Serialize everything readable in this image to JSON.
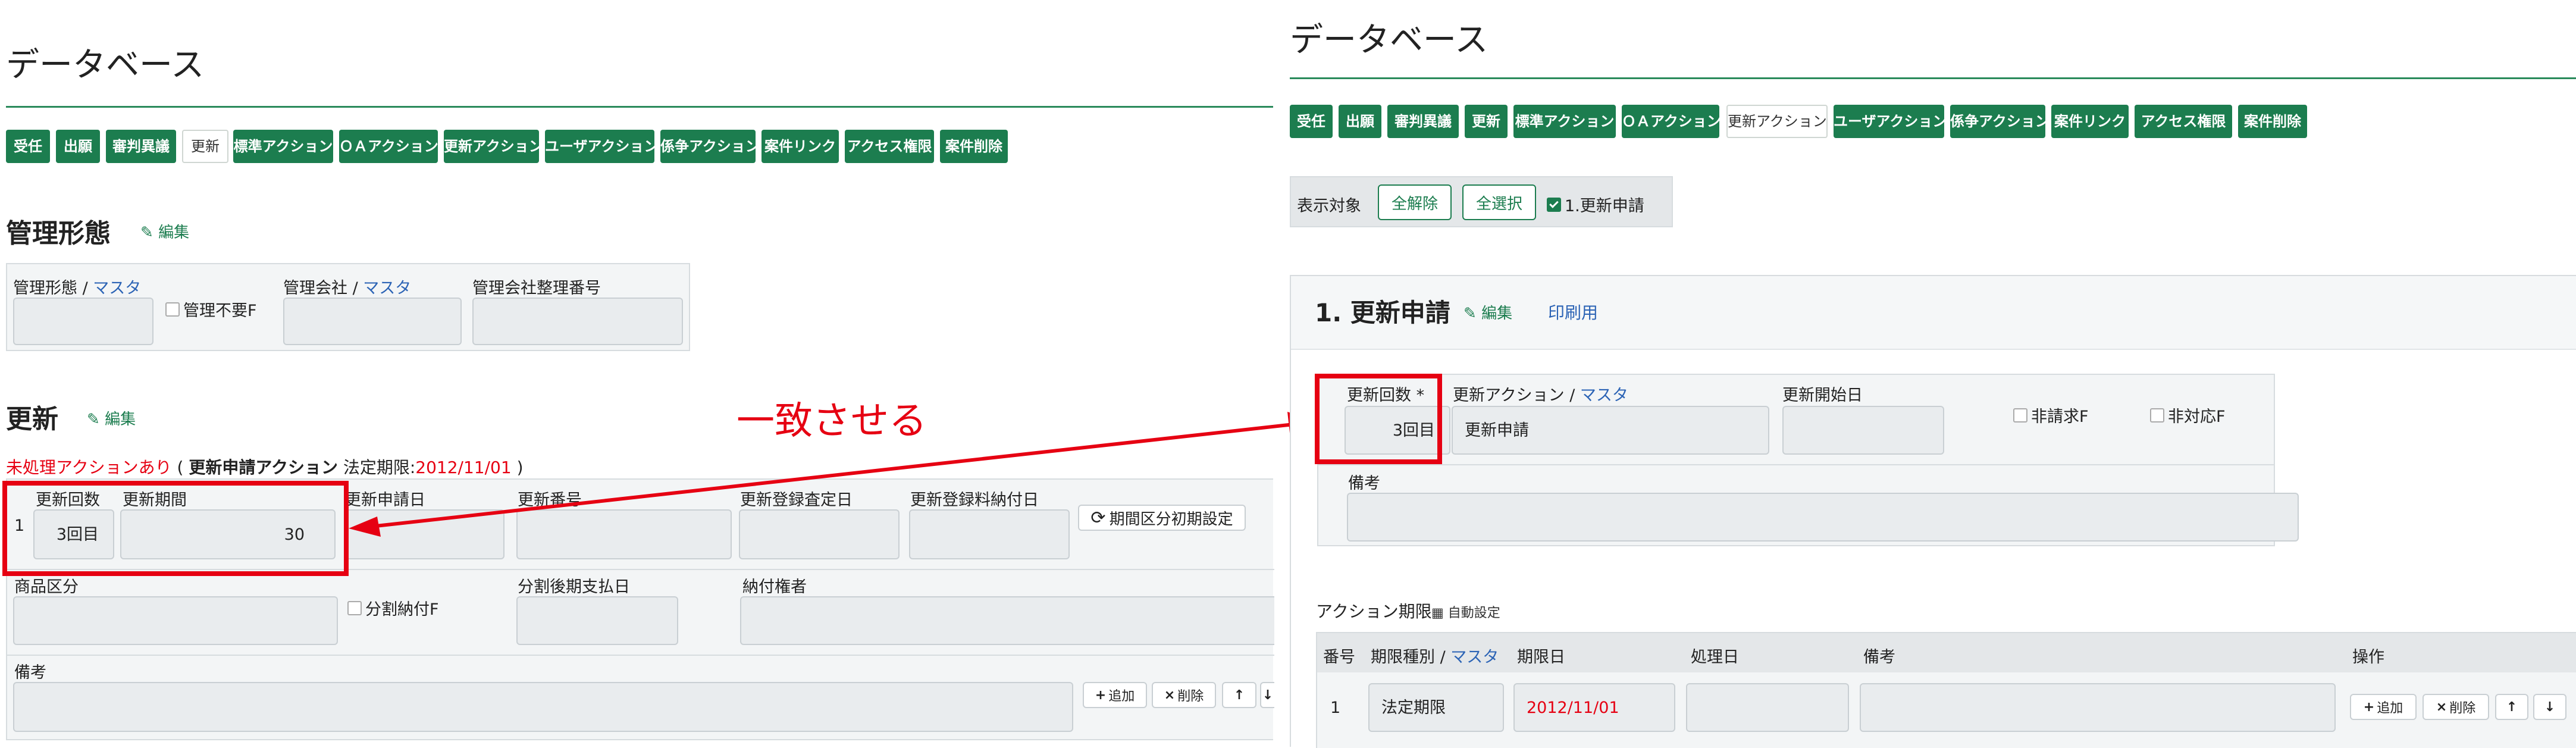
{
  "left": {
    "page_title": "データベース",
    "tabs": [
      "受任",
      "出願",
      "審判異議",
      "更新",
      "標準アクション",
      "ＯＡアクション",
      "更新アクション",
      "ユーザアクション",
      "係争アクション",
      "案件リンク",
      "アクセス権限",
      "案件削除"
    ],
    "kanri": {
      "title": "管理形態",
      "edit": "編集",
      "label_keitai": "管理形態",
      "sep": " / ",
      "master": "マスタ",
      "chk_fuyou": "管理不要F",
      "label_kaisha": "管理会社",
      "label_seiri": "管理会社整理番号"
    },
    "koshin": {
      "title": "更新",
      "edit": "編集",
      "notice_prefix": "未処理アクションあり",
      "notice_paren_open": " ( ",
      "notice_action": "更新申請アクション",
      "notice_deadline_label": " 法定期限:",
      "notice_date": "2012/11/01",
      "notice_paren_close": " )",
      "row_no": "1",
      "label_kaisu": "更新回数",
      "label_kikan": "更新期間",
      "label_shinseibi": "更新申請日",
      "label_bango": "更新番号",
      "label_satei": "更新登録査定日",
      "label_nofu": "更新登録料納付日",
      "reset_btn": "期間区分初期設定",
      "val_kaisu": "3回目",
      "val_kikan": "30",
      "label_shohin": "商品区分",
      "chk_bunkatsu": "分割納付F",
      "label_bunkatsugo": "分割後期支払日",
      "label_nofusha": "納付権者",
      "label_biko": "備考",
      "btn_add": "追加",
      "btn_del": "削除"
    },
    "annotation": "一致させる"
  },
  "right": {
    "page_title": "データベース",
    "tabs": [
      "受任",
      "出願",
      "審判異議",
      "更新",
      "標準アクション",
      "ＯＡアクション",
      "更新アクション",
      "ユーザアクション",
      "係争アクション",
      "案件リンク",
      "アクセス権限",
      "案件削除"
    ],
    "filter": {
      "label": "表示対象",
      "btn_clear": "全解除",
      "btn_all": "全選択",
      "chk_item": "1.更新申請"
    },
    "sec1": {
      "title": "1. 更新申請",
      "edit": "編集",
      "print": "印刷用",
      "label_kaisu": "更新回数",
      "required": " *",
      "label_action": "更新アクション",
      "sep": " / ",
      "master": "マスタ",
      "label_kaishi": "更新開始日",
      "chk_hiseikyu": "非請求F",
      "chk_taiou": "非対応F",
      "val_kaisu": "3回目",
      "val_action": "更新申請",
      "label_biko": "備考"
    },
    "kigen": {
      "title": "アクション期限",
      "auto": "自動設定",
      "col_no": "番号",
      "col_shubetsu": "期限種別",
      "col_kigenbi": "期限日",
      "col_shoribi": "処理日",
      "col_biko": "備考",
      "col_sousa": "操作",
      "sep": " / ",
      "master": "マスタ",
      "row_no": "1",
      "row_shubetsu": "法定期限",
      "row_kigenbi": "2012/11/01",
      "btn_add": "追加",
      "btn_del": "削除"
    }
  },
  "colors": {
    "accent": "#1c7d4f",
    "annotation_red": "#e60012",
    "master_blue": "#2b63b5"
  }
}
